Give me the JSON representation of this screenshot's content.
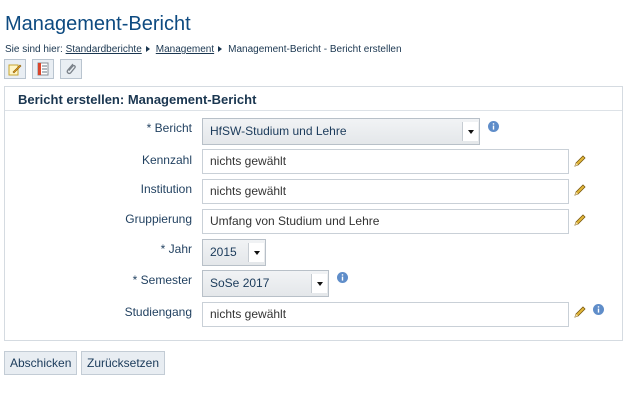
{
  "page": {
    "title": "Management-Bericht"
  },
  "breadcrumb": {
    "prefix": "Sie sind hier:",
    "items": [
      "Standardberichte",
      "Management",
      "Management-Bericht - Bericht erstellen"
    ]
  },
  "toolbar": {
    "buttons": [
      {
        "icon": "edit-note-icon"
      },
      {
        "icon": "report-icon"
      },
      {
        "icon": "attachment-icon"
      }
    ]
  },
  "form": {
    "title": "Bericht erstellen: Management-Bericht",
    "fields": {
      "bericht": {
        "label": "* Bericht",
        "value": "HfSW-Studium und Lehre"
      },
      "kennzahl": {
        "label": "Kennzahl",
        "value": "nichts gewählt"
      },
      "institution": {
        "label": "Institution",
        "value": "nichts gewählt"
      },
      "gruppierung": {
        "label": "Gruppierung",
        "value": "Umfang von Studium und Lehre"
      },
      "jahr": {
        "label": "* Jahr",
        "value": "2015"
      },
      "semester": {
        "label": "* Semester",
        "value": "SoSe 2017"
      },
      "studiengang": {
        "label": "Studiengang",
        "value": "nichts gewählt"
      }
    }
  },
  "actions": {
    "submit": "Abschicken",
    "reset": "Zurücksetzen"
  },
  "colors": {
    "title": "#0d4a80",
    "info_icon": "#5f8dc9",
    "pencil": "#e4b83a"
  }
}
